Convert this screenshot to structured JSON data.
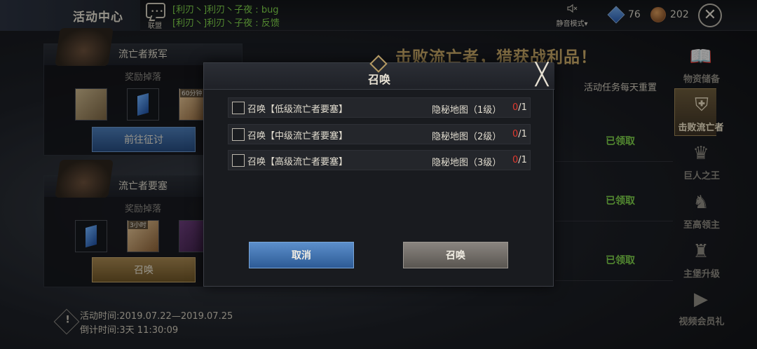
{
  "header": {
    "title": "活动中心",
    "alliance_label": "联盟",
    "alliance_dots": "•••",
    "chat": [
      {
        "prefix": "[利刃丶]利刃丶子夜",
        "separator": " : ",
        "message": "bug"
      },
      {
        "prefix": "[利刃丶]利刃丶子夜",
        "separator": " : ",
        "message": "反馈"
      }
    ],
    "mute_label": "静音模式",
    "mute_arrow": "▾",
    "gems": "76",
    "ore": "202",
    "close_glyph": "✕"
  },
  "cards": [
    {
      "title": "流亡者叛军",
      "reward_label": "奖励掉落",
      "item_tag": "60分钟",
      "button_label": "前往征讨"
    },
    {
      "title": "流亡者要塞",
      "reward_label": "奖励掉落",
      "item_tag": "3小时",
      "button_label": "召唤"
    }
  ],
  "activity": {
    "time_label": "活动时间:",
    "time_value": "2019.07.22—2019.07.25",
    "countdown_label": "倒计时间:",
    "countdown_value": "3天 11:30:09",
    "info_glyph": "!"
  },
  "main": {
    "banner": "击败流亡者，猎获战利品！",
    "reset_note": "活动任务每天重置",
    "claimed": [
      "已领取",
      "已领取",
      "已领取"
    ]
  },
  "sidebar": {
    "items": [
      {
        "label": "物资储备",
        "icon": "book-icon",
        "glyph": "📖",
        "active": false
      },
      {
        "label": "击败流亡者",
        "icon": "helmet-icon",
        "glyph": "⛨",
        "active": true
      },
      {
        "label": "巨人之王",
        "icon": "crown-hammer-icon",
        "glyph": "♛",
        "active": false
      },
      {
        "label": "至高领主",
        "icon": "knight-helmet-icon",
        "glyph": "♞",
        "active": false
      },
      {
        "label": "主堡升级",
        "icon": "castle-icon",
        "glyph": "♜",
        "active": false
      },
      {
        "label": "视频会员礼",
        "icon": "play-icon",
        "glyph": "▶",
        "active": false
      }
    ]
  },
  "modal": {
    "title": "召唤",
    "close_glyph": "╳",
    "rows": [
      {
        "name": "召唤【低级流亡者要塞】",
        "map": "隐秘地图（1级）",
        "current": "0",
        "total": "/1",
        "checked": false
      },
      {
        "name": "召唤【中级流亡者要塞】",
        "map": "隐秘地图（2级）",
        "current": "0",
        "total": "/1",
        "checked": false
      },
      {
        "name": "召唤【高级流亡者要塞】",
        "map": "隐秘地图（3级）",
        "current": "0",
        "total": "/1",
        "checked": false
      }
    ],
    "cancel_label": "取消",
    "summon_label": "召唤"
  },
  "colors": {
    "chat_green": "#7fd14a",
    "banner_gold": "#c9a968",
    "count_red": "#e03a2f",
    "cancel_blue": "#2d5b96",
    "summon_gray": "#5a5651"
  }
}
